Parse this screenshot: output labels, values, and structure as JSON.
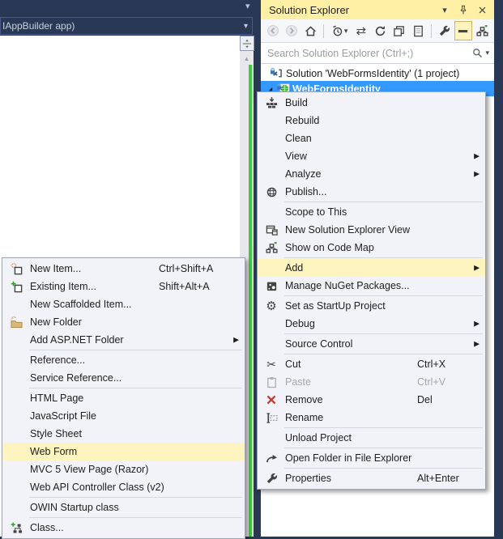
{
  "colors": {
    "navy": "#293955",
    "title_bar": "#FFF0A6",
    "title_text": "#1E1E1E",
    "selection": "#3399FF",
    "menu_bg": "#F1F3F8",
    "menu_border": "#A0A5B0",
    "highlight": "#FDF4BF",
    "separator": "#D4D8E0",
    "green_bar": "#3FCB3F",
    "disabled_text": "#A6A7AB",
    "toolbar_bg": "#F6F7F9",
    "scroll_strip": "#E8E8EC",
    "remove_red": "#C23B2E",
    "text": "#1E1E1E",
    "placeholder": "#9A9B9D",
    "toggle_bg": "#FDF4BF",
    "toggle_border": "#D2B85A"
  },
  "editor": {
    "nav_combo_text": "IAppBuilder app)"
  },
  "solution_explorer": {
    "title": "Solution Explorer",
    "title_buttons": [
      {
        "name": "window-position-button",
        "icon": "chevron-down"
      },
      {
        "name": "pin-button",
        "icon": "pin"
      },
      {
        "name": "close-button",
        "icon": "close"
      }
    ],
    "toolbar_buttons": [
      {
        "name": "back-button",
        "icon": "back",
        "disabled": true
      },
      {
        "name": "forward-button",
        "icon": "forward",
        "disabled": true
      },
      {
        "name": "home-button",
        "icon": "home"
      },
      {
        "type": "separator"
      },
      {
        "name": "pending-changes-filter-button",
        "icon": "history",
        "caret": true
      },
      {
        "name": "sync-with-active-document-button",
        "icon": "sync"
      },
      {
        "name": "refresh-button",
        "icon": "refresh"
      },
      {
        "name": "collapse-all-button",
        "icon": "collapse-all"
      },
      {
        "name": "preview-selected-items-button",
        "icon": "preview"
      },
      {
        "type": "separator"
      },
      {
        "name": "properties-button",
        "icon": "wrench"
      },
      {
        "name": "show-all-files-button",
        "icon": "show-all-files",
        "toggled": true
      },
      {
        "name": "new-solution-explorer-view-button",
        "icon": "code-map"
      }
    ],
    "search": {
      "placeholder": "Search Solution Explorer (Ctrl+;)",
      "icon": "magnifier"
    },
    "tree": [
      {
        "label": "Solution 'WebFormsIdentity' (1 project)",
        "icon": "solution",
        "indent": 0
      },
      {
        "label": "WebFormsIdentity",
        "icon": "project",
        "indent": 1,
        "selected": true,
        "expanded": true
      }
    ]
  },
  "context_menu": {
    "items": [
      {
        "label": "Build",
        "icon": "build"
      },
      {
        "label": "Rebuild"
      },
      {
        "label": "Clean"
      },
      {
        "label": "View",
        "submenu": true
      },
      {
        "label": "Analyze",
        "submenu": true
      },
      {
        "label": "Publish...",
        "icon": "publish"
      },
      {
        "type": "separator"
      },
      {
        "label": "Scope to This"
      },
      {
        "label": "New Solution Explorer View",
        "icon": "new-view"
      },
      {
        "label": "Show on Code Map",
        "icon": "code-map"
      },
      {
        "type": "separator"
      },
      {
        "label": "Add",
        "submenu": true,
        "highlighted": true
      },
      {
        "label": "Manage NuGet Packages...",
        "icon": "nuget"
      },
      {
        "type": "separator"
      },
      {
        "label": "Set as StartUp Project",
        "icon": "gear"
      },
      {
        "label": "Debug",
        "submenu": true
      },
      {
        "type": "separator"
      },
      {
        "label": "Source Control",
        "submenu": true
      },
      {
        "type": "separator"
      },
      {
        "label": "Cut",
        "icon": "cut",
        "shortcut": "Ctrl+X"
      },
      {
        "label": "Paste",
        "icon": "paste",
        "shortcut": "Ctrl+V",
        "disabled": true
      },
      {
        "label": "Remove",
        "icon": "remove",
        "shortcut": "Del"
      },
      {
        "label": "Rename",
        "icon": "rename"
      },
      {
        "type": "separator"
      },
      {
        "label": "Unload Project"
      },
      {
        "type": "separator"
      },
      {
        "label": "Open Folder in File Explorer",
        "icon": "open-folder"
      },
      {
        "type": "separator"
      },
      {
        "label": "Properties",
        "icon": "wrench",
        "shortcut": "Alt+Enter"
      }
    ]
  },
  "add_submenu": {
    "items": [
      {
        "label": "New Item...",
        "icon": "new-item",
        "shortcut": "Ctrl+Shift+A"
      },
      {
        "label": "Existing Item...",
        "icon": "existing-item",
        "shortcut": "Shift+Alt+A"
      },
      {
        "label": "New Scaffolded Item..."
      },
      {
        "label": "New Folder",
        "icon": "new-folder"
      },
      {
        "label": "Add ASP.NET Folder",
        "submenu": true
      },
      {
        "type": "separator"
      },
      {
        "label": "Reference..."
      },
      {
        "label": "Service Reference..."
      },
      {
        "type": "separator"
      },
      {
        "label": "HTML Page"
      },
      {
        "label": "JavaScript File"
      },
      {
        "label": "Style Sheet"
      },
      {
        "label": "Web Form",
        "highlighted": true
      },
      {
        "label": "MVC 5 View Page (Razor)"
      },
      {
        "label": "Web API Controller Class (v2)"
      },
      {
        "type": "separator"
      },
      {
        "label": "OWIN Startup class"
      },
      {
        "type": "separator"
      },
      {
        "label": "Class...",
        "icon": "class"
      }
    ]
  }
}
